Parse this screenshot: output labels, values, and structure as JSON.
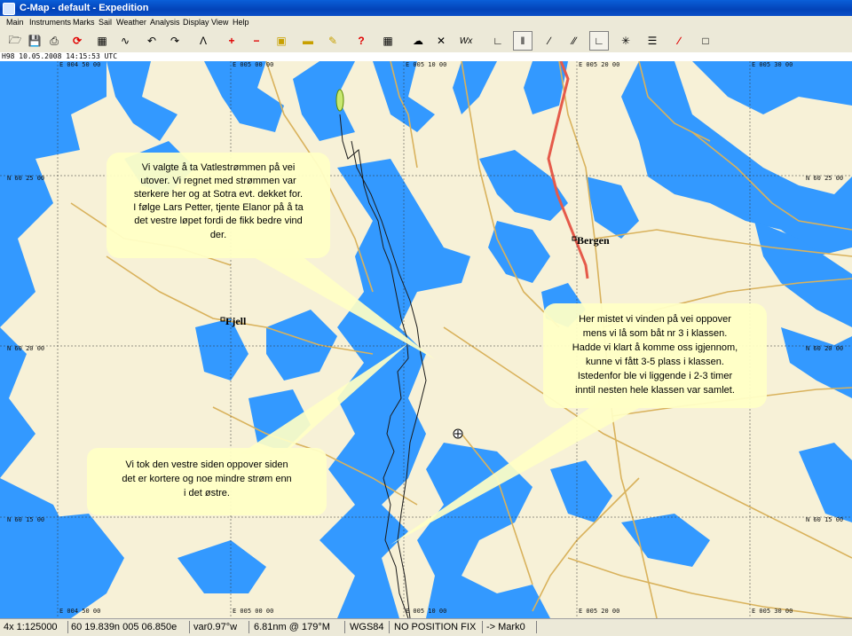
{
  "window": {
    "title": "C-Map - default - Expedition"
  },
  "menu": [
    "Main",
    "Instruments",
    "Marks",
    "Sail",
    "Weather",
    "Analysis",
    "Display",
    "View",
    "Help"
  ],
  "clock": "H98 10.05.2008 14:15:53 UTC",
  "map": {
    "colors": {
      "land": "#f7f1d7",
      "water": "#3399ff",
      "road": "#d9b25c",
      "route": "#e55a4a",
      "track": "#1a1a1a",
      "callout": "#ffffc6"
    },
    "longitude_labels": [
      "E 004 50 00",
      "E 005 00 00",
      "E 005 10 00",
      "E 005 20 00",
      "E 005 30 00"
    ],
    "latitude_labels": [
      "N 60 25 00",
      "N 60 20 00",
      "N 60 15 00"
    ],
    "places": {
      "bergen": "Bergen",
      "fjell": "Fjell"
    },
    "callouts": {
      "vatlestrommen": [
        "Vi valgte å ta Vatlestrømmen på vei",
        "utover. Vi regnet med strømmen var",
        "sterkere her og at Sotra evt. dekket for.",
        "I følge Lars Petter, tjente Elanor på å ta",
        "det vestre løpet fordi de fikk bedre vind",
        "der."
      ],
      "oppover": [
        "Her mistet vi vinden på vei oppover",
        "mens vi lå som båt nr 3 i klassen.",
        "Hadde vi klart å komme oss igjennom,",
        "kunne vi fått 3-5 plass i klassen.",
        "Istedenfor ble vi liggende i 2-3 timer",
        "inntil nesten hele klassen var samlet."
      ],
      "vestre": [
        "Vi tok den vestre siden oppover siden",
        "det er kortere og noe mindre strøm enn",
        "i det østre."
      ]
    }
  },
  "status": {
    "scale": "4x 1:125000",
    "position": "60 19.839n 005 06.850e",
    "variation": "var0.97°w",
    "range_bearing": "6.81nm @ 179°M",
    "datum": "WGS84",
    "fix": "NO POSITION FIX",
    "waypoint": "-> Mark0"
  }
}
